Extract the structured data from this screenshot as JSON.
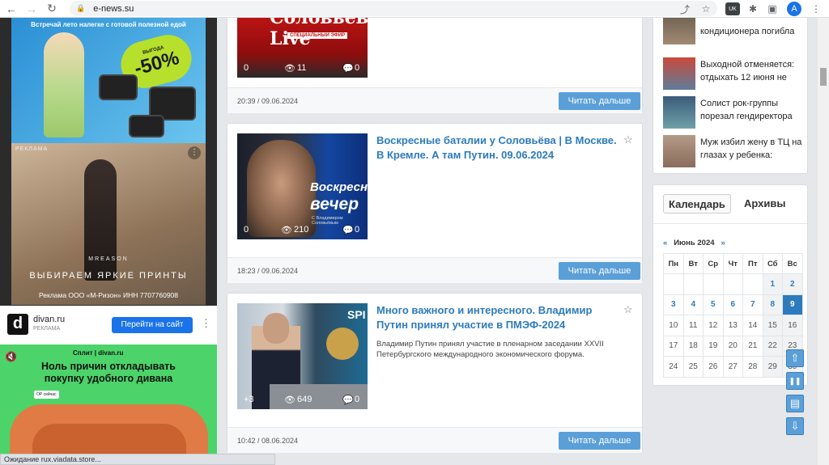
{
  "browser": {
    "url": "e-news.su",
    "profile_initial": "A",
    "translate_badge": "UK",
    "status_text": "Ожидание rux.viadata.store..."
  },
  "ads": {
    "ad1": {
      "headline": "Встречай лето налегке с готовой полезной едой",
      "badge_small": "ВЫГОДА",
      "badge_big": "-50%"
    },
    "ad2": {
      "tag": "РЕКЛАМА",
      "brand": "MREASON",
      "slogan": "ВЫБИРАЕМ ЯРКИЕ ПРИНТЫ",
      "legal": "Реклама ООО «М-Ризон» ИНН 7707760908"
    },
    "ad3": {
      "logo_letter": "d",
      "name": "divan.ru",
      "label": "РЕКЛАМА",
      "cta": "Перейти на сайт"
    },
    "ad4": {
      "brandline": "Сплит | divan.ru",
      "title": "Ноль причин откладывать покупку удобного дивана",
      "chip": "ОР сейчас"
    }
  },
  "feed": [
    {
      "title": "",
      "thumb_logo": "Соловьёв Live",
      "thumb_sub": "СПЕЦИАЛЬНЫЙ ЭФИР",
      "comments_left": "0",
      "views": "11",
      "comments": "0",
      "time": "20:39 / 09.06.2024",
      "more": "Читать дальше"
    },
    {
      "title": "Воскресные баталии у Соловьёва | В Москве. В Кремле. А там Путин. 09.06.2024",
      "thumb_line1": "Воскресный",
      "thumb_line2": "вечер",
      "thumb_line3": "С Владимиром Соловьёвым",
      "comments_left": "0",
      "views": "210",
      "comments": "0",
      "time": "18:23 / 09.06.2024",
      "more": "Читать дальше"
    },
    {
      "title": "Много важного и интересного. Владимир Путин принял участие в ПМЭФ-2024",
      "excerpt": "Владимир Путин принял участие в пленарном заседании XXVII Петербургского международного экономического форума.",
      "thumb_spb": "SPI",
      "comments_left": "+3",
      "views": "649",
      "comments": "0",
      "time": "10:42 / 08.06.2024",
      "more": "Читать дальше"
    }
  ],
  "sidebar_news": [
    {
      "title": "кондиционера погибла"
    },
    {
      "title": "Выходной отменяется: отдыхать 12 июня не"
    },
    {
      "title": "Солист рок-группы порезал гендиректора"
    },
    {
      "title": "Муж избил жену в ТЦ на глазах у ребенка:"
    }
  ],
  "calendar": {
    "tab_calendar": "Календарь",
    "tab_archive": "Архивы",
    "prev": "«",
    "next": "»",
    "month": "Июнь 2024",
    "weekdays": [
      "Пн",
      "Вт",
      "Ср",
      "Чт",
      "Пт",
      "Сб",
      "Вс"
    ],
    "weeks": [
      [
        "",
        "",
        "",
        "",
        "",
        "1",
        "2"
      ],
      [
        "3",
        "4",
        "5",
        "6",
        "7",
        "8",
        "9"
      ],
      [
        "10",
        "11",
        "12",
        "13",
        "14",
        "15",
        "16"
      ],
      [
        "17",
        "18",
        "19",
        "20",
        "21",
        "22",
        "23"
      ],
      [
        "24",
        "25",
        "26",
        "27",
        "28",
        "29",
        "30"
      ]
    ],
    "linked_days": [
      "1",
      "2",
      "3",
      "4",
      "5",
      "6",
      "7",
      "8"
    ],
    "today": "9"
  },
  "floating_buttons": {
    "up": "⇧",
    "pause": "❚❚",
    "book": "▤",
    "down": "⇩"
  }
}
